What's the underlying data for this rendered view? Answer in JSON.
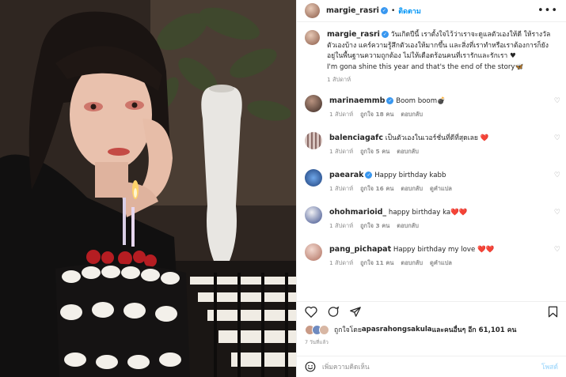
{
  "post": {
    "username": "margie_rasri",
    "follow_label": "ติดตาม",
    "dot": "•",
    "more": "•••"
  },
  "caption": {
    "username": "margie_rasri",
    "text": "วันเกิดปีนี้ เราตั้งใจไว้ว่าเราจะดูแลตัวเองให้ดี ให้รางวัลตัวเองบ้าง แคร์ความรู้สึกตัวเองให้มากขึ้น และสิ่งที่เราทำหรือเราต้องการก็ยังอยู่ในพื้นฐานความถูกต้อง ไม่ให้เดือดร้อนคนที่เรารักและรักเรา ♥",
    "text_en": "I'm gona shine this year and that's the end of the story🦋",
    "time": "1 สัปดาห์"
  },
  "comments": [
    {
      "user": "marinaemmb",
      "verified": true,
      "text": "Boom boom💣",
      "time": "1 สัปดาห์",
      "likes": "ถูกใจ 18 คน",
      "reply": "ตอบกลับ",
      "translate": ""
    },
    {
      "user": "balenciagafc",
      "verified": false,
      "text": "เป็นตัวเองในเวอร์ชั่นที่ดีที่สุดเลย ❤️",
      "time": "1 สัปดาห์",
      "likes": "ถูกใจ 5 คน",
      "reply": "ตอบกลับ",
      "translate": ""
    },
    {
      "user": "paearak",
      "verified": true,
      "text": "Happy birthday kabb",
      "time": "1 สัปดาห์",
      "likes": "ถูกใจ 16 คน",
      "reply": "ตอบกลับ",
      "translate": "ดูคำแปล"
    },
    {
      "user": "ohohmarioid_",
      "verified": false,
      "text": "happy birthday ka❤️❤️",
      "time": "1 สัปดาห์",
      "likes": "ถูกใจ 3 คน",
      "reply": "ตอบกลับ",
      "translate": ""
    },
    {
      "user": "pang_pichapat",
      "verified": false,
      "text": "Happy birthday my love ❤️❤️",
      "time": "1 สัปดาห์",
      "likes": "ถูกใจ 11 คน",
      "reply": "ตอบกลับ",
      "translate": "ดูคำแปล"
    }
  ],
  "likes": {
    "prefix": "ถูกใจโดย ",
    "user": "apasrahongsakula",
    "suffix": " และคนอื่นๆ อีก 61,101 คน"
  },
  "date": "7 วันที่แล้ว",
  "add_comment": {
    "placeholder": "เพิ่มความคิดเห็น",
    "post": "โพสต์"
  },
  "colors": {
    "accent": "#0095f6",
    "verified": "#3897f0",
    "muted": "#8e8e8e",
    "heart_red": "#d4202b"
  }
}
